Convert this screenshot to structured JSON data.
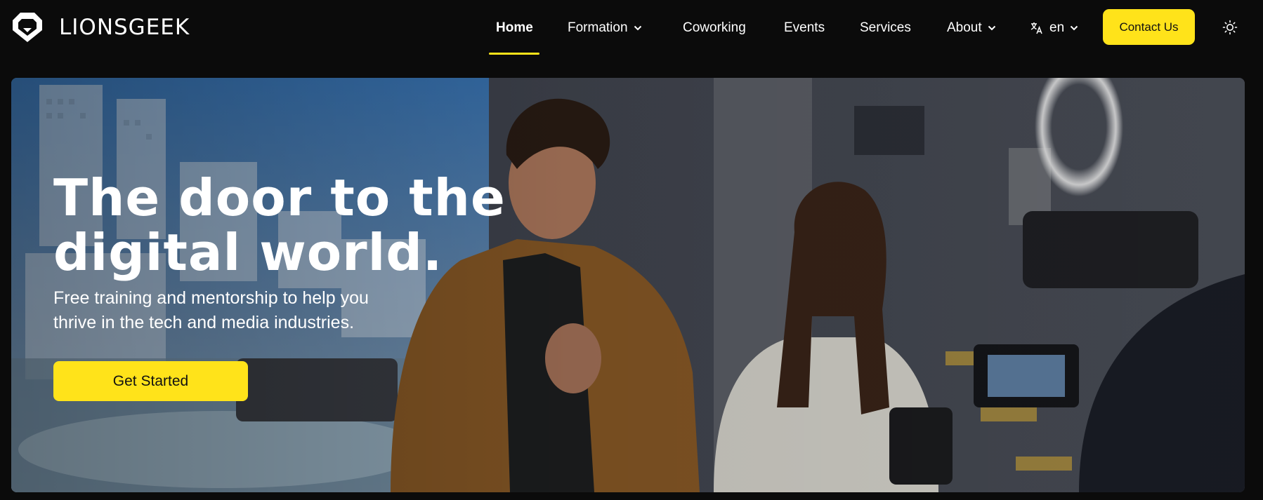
{
  "brand": {
    "name": "LIONSGEEK",
    "accent": "#ffe31a"
  },
  "nav": {
    "home": "Home",
    "formation": "Formation",
    "coworking": "Coworking",
    "events": "Events",
    "services": "Services",
    "about": "About",
    "language": "en",
    "contact": "Contact Us"
  },
  "icons": {
    "language": "translate-icon",
    "theme": "sun-icon",
    "dropdown": "chevron-down-icon"
  },
  "hero": {
    "title_line1": "The door to the",
    "title_line2": "digital world.",
    "subtitle_line1": "Free training and mentorship to help you",
    "subtitle_line2": "thrive in the tech and media industries.",
    "cta": "Get Started"
  }
}
